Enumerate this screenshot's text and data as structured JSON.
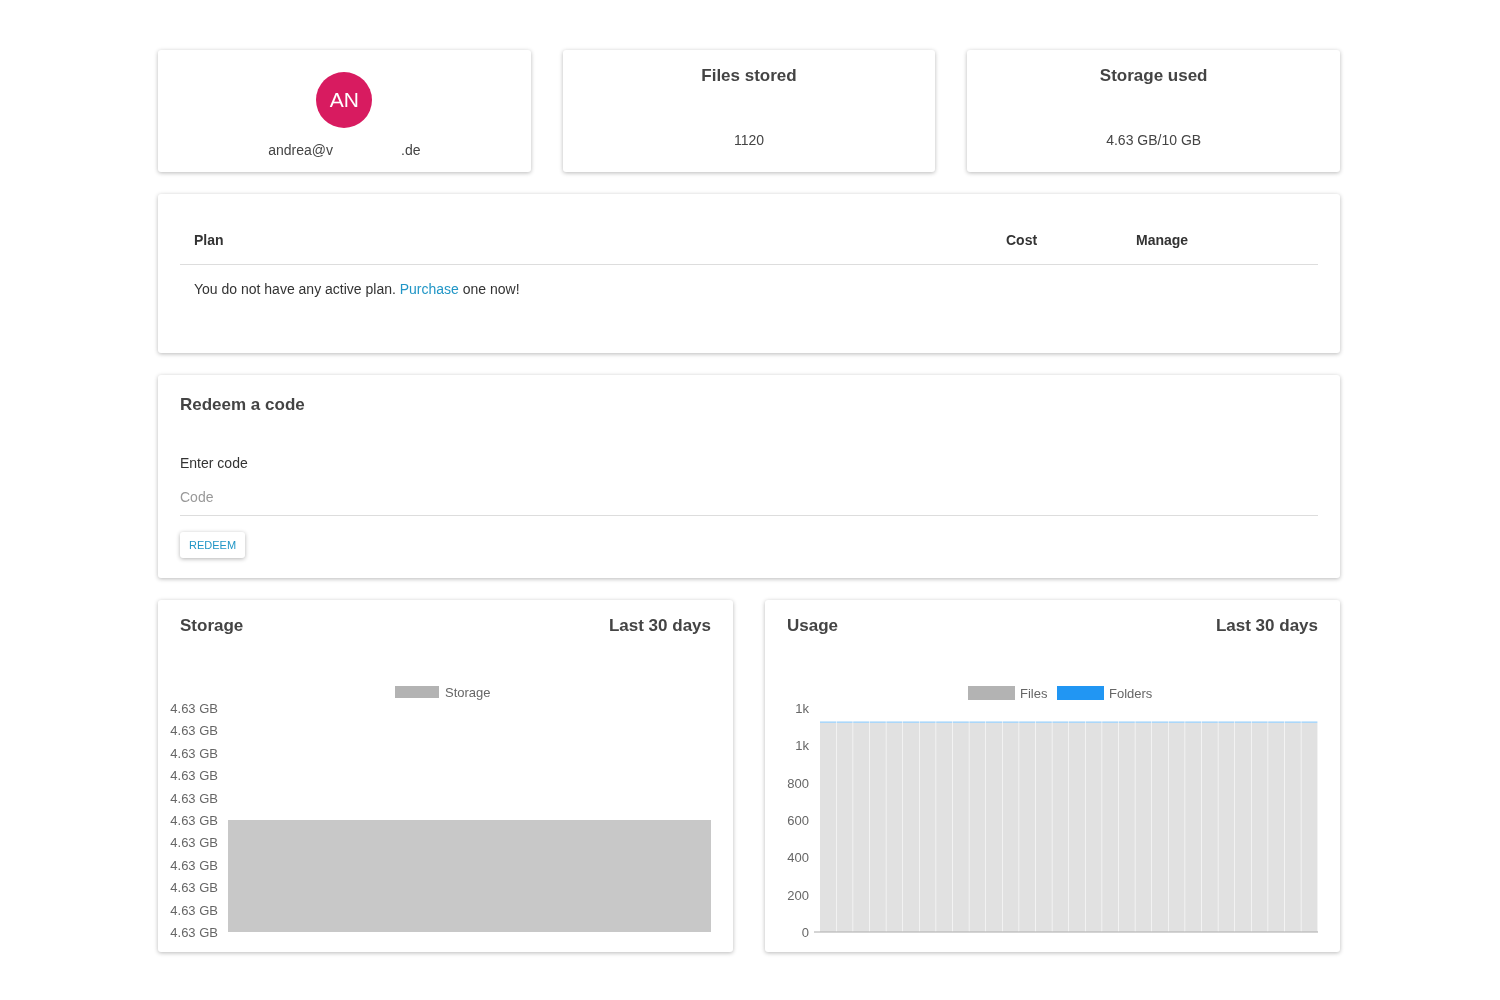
{
  "profile": {
    "initials": "AN",
    "email_parts": [
      "andrea@v",
      ".de"
    ]
  },
  "stats": [
    {
      "title": "Files stored",
      "value": "1120"
    },
    {
      "title": "Storage used",
      "value": "4.63 GB/10 GB"
    }
  ],
  "plan_table": {
    "columns": [
      "Plan",
      "Cost",
      "Manage"
    ],
    "message": "You do not have any active plan. ",
    "link": "Purchase",
    "message_end": " one now!"
  },
  "redeem": {
    "title": "Redeem a code",
    "field_label": "Enter code",
    "placeholder": "Code",
    "button": "REDEEM"
  },
  "storage_chart": {
    "title": "Storage",
    "period": "Last 30 days",
    "legend": [
      {
        "name": "Storage",
        "color": "#b3b3b3"
      }
    ],
    "axis_labels": [
      "4.63 GB",
      "4.63 GB",
      "4.63 GB",
      "4.63 GB",
      "4.63 GB",
      "4.63 GB",
      "4.63 GB",
      "4.63 GB",
      "4.63 GB",
      "4.63 GB",
      "4.63 GB"
    ]
  },
  "usage_chart": {
    "title": "Usage",
    "period": "Last 30 days",
    "chart_data": {
      "type": "bar",
      "stacked": true,
      "legend": "top",
      "ylim": [
        0,
        1200
      ],
      "yticks": [
        {
          "value": 0,
          "label": "0"
        },
        {
          "value": 200,
          "label": "200"
        },
        {
          "value": 400,
          "label": "400"
        },
        {
          "value": 600,
          "label": "600"
        },
        {
          "value": 800,
          "label": "800"
        },
        {
          "value": 1000,
          "label": "1k"
        },
        {
          "value": 1200,
          "label": "1k"
        }
      ],
      "series": [
        {
          "name": "Files",
          "color": "#b3b3b3",
          "values": [
            1120,
            1120,
            1120,
            1120,
            1120,
            1120,
            1120,
            1120,
            1120,
            1120,
            1120,
            1120,
            1120,
            1120,
            1120,
            1120,
            1120,
            1120,
            1120,
            1120,
            1120,
            1120,
            1120,
            1120,
            1120,
            1120,
            1120,
            1120,
            1120,
            1120
          ]
        },
        {
          "name": "Folders",
          "color": "#2196f3",
          "values": [
            0,
            0,
            0,
            0,
            0,
            0,
            0,
            0,
            0,
            0,
            0,
            0,
            0,
            0,
            0,
            0,
            0,
            0,
            0,
            0,
            0,
            0,
            0,
            0,
            0,
            0,
            0,
            0,
            0,
            0
          ]
        }
      ]
    }
  }
}
